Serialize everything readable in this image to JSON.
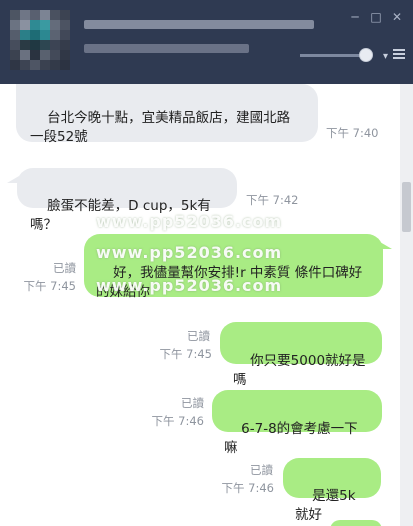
{
  "window": {
    "controls": {
      "minimize": "─",
      "maximize": "□",
      "close": "✕"
    }
  },
  "messages": [
    {
      "direction": "incoming",
      "text": "台北今晚十點，宜美精品飯店，建國北路\n一段52號",
      "time": "下午 7:40"
    },
    {
      "direction": "incoming",
      "text": "臉蛋不能差，D cup，5k有嗎？",
      "time": "下午 7:42"
    },
    {
      "direction": "outgoing",
      "text": "好，我儘量幫你安排!r 中素質 條件口碑好\n的妹給你",
      "read": "已讀",
      "time": "下午 7:45"
    },
    {
      "direction": "outgoing",
      "text": "你只要5000就好是嗎",
      "read": "已讀",
      "time": "下午 7:45"
    },
    {
      "direction": "outgoing",
      "text": "6-7-8的會考慮一下嘛",
      "read": "已讀",
      "time": "下午 7:46"
    },
    {
      "direction": "outgoing",
      "text": "是還5k就好",
      "read": "已讀",
      "time": "下午 7:46"
    }
  ],
  "watermarks": [
    "www.pp52036.com",
    "www.pp52036.com",
    "www.pp52036.com"
  ],
  "colors": {
    "header": "#2f3a52",
    "incoming_bubble": "#e9ebef",
    "outgoing_bubble": "#a9ec84",
    "meta_text": "#8f959f"
  },
  "icons": {
    "menu": "hamburger-icon",
    "more": "chevron-down-icon"
  }
}
